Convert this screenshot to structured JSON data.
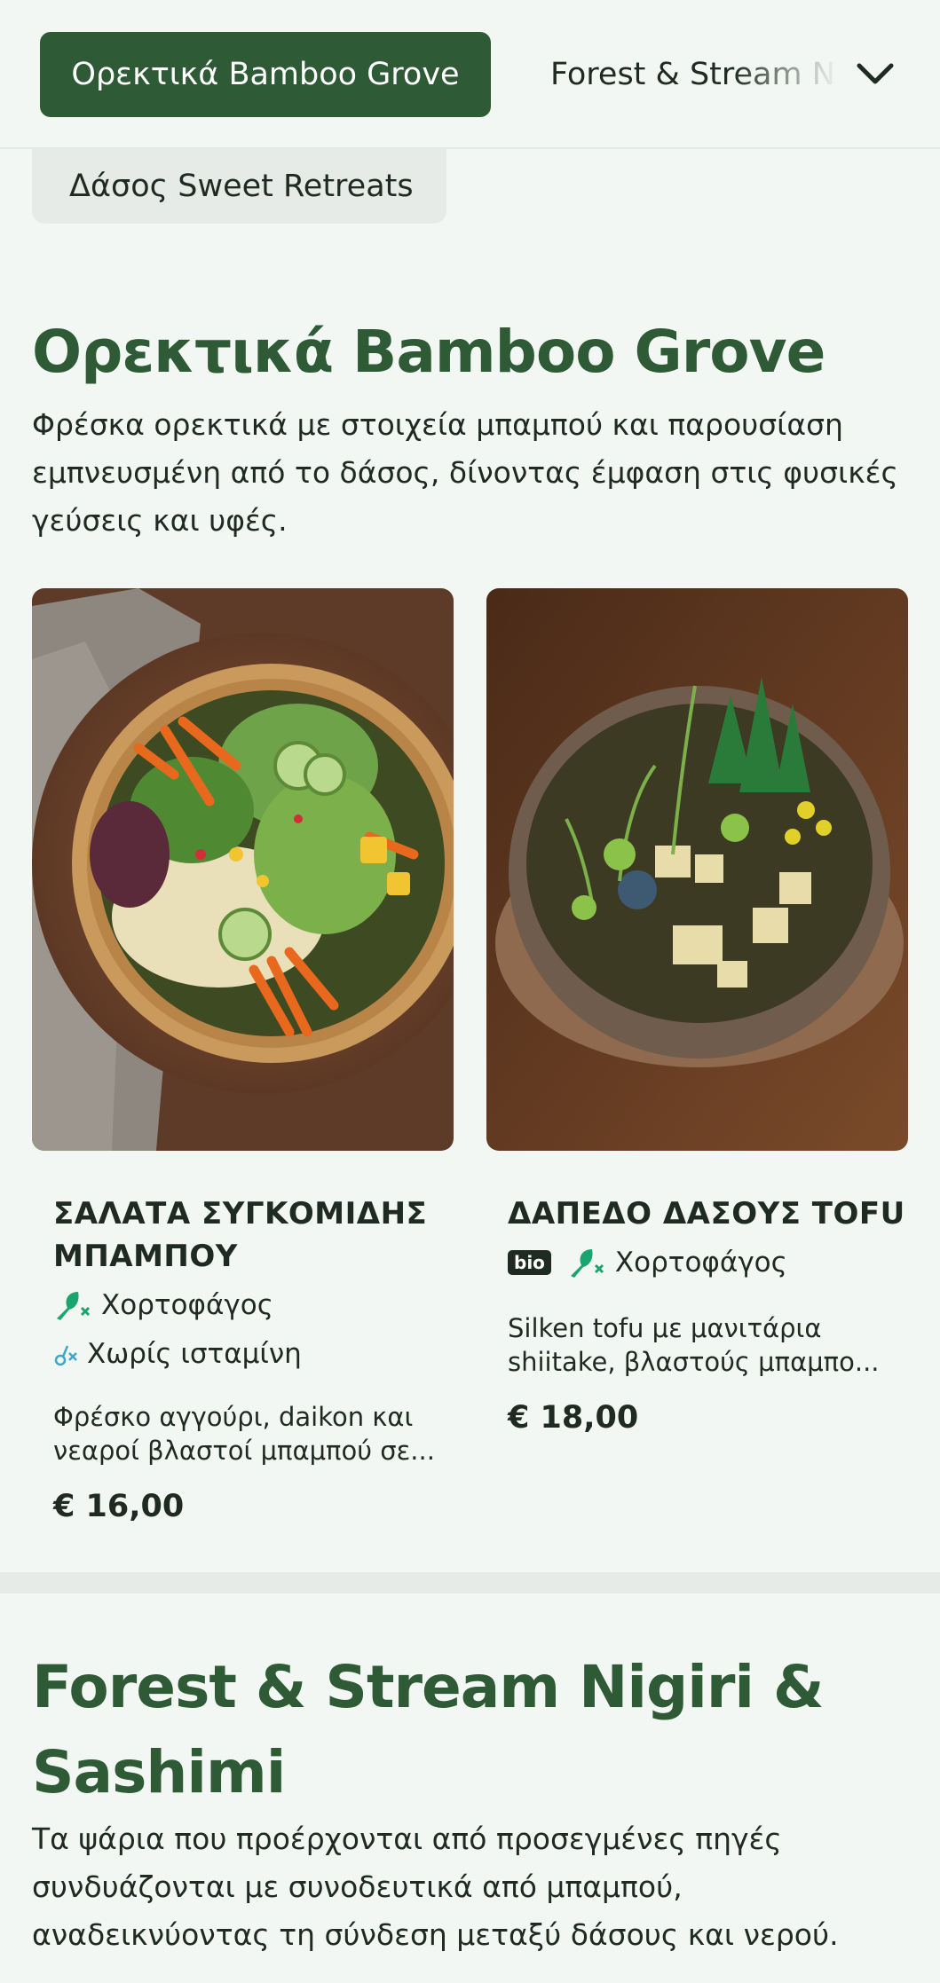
{
  "nav": {
    "active_tab": "Ορεκτικά Bamboo Grove",
    "next_tab": "Forest & Stream Nigiri & Sashimi",
    "below_tab": "Δάσος Sweet Retreats",
    "expand_icon": "chevron-down-icon"
  },
  "sections": [
    {
      "title": "Ορεκτικά Bamboo Grove",
      "description": "Φρέσκα ορεκτικά με στοιχεία μπαμπού και παρουσίαση εμπνευσμένη από το δάσος, δίνοντας έμφαση στις φυσικές γεύσεις και υφές.",
      "items": [
        {
          "title_line1": "ΣΑΛΑΤΑ ΣΥΓΚΟΜΙΔΗΣ",
          "title_line2": "ΜΠΑΜΠΟΥ",
          "tags": [
            "Χορτοφάγος",
            "Χωρίς ισταμίνη"
          ],
          "description_line1": "Φρέσκο αγγούρι, daikon και",
          "description_line2": "νεαροί βλαστοί μπαμπού σε...",
          "price": "€ 16,00"
        },
        {
          "title_line1": "ΔΑΠΕΔΟ ΔΑΣΟΥΣ TOFU",
          "badge": "bio",
          "tags": [
            "Χορτοφάγος"
          ],
          "description_line1": "Silken tofu με μανιτάρια",
          "description_line2": "shiitake, βλαστούς μπαμπο...",
          "price": "€ 18,00"
        }
      ]
    },
    {
      "title_line1": "Forest & Stream Nigiri &",
      "title_line2": "Sashimi",
      "description": "Τα ψάρια που προέρχονται από προσεγμένες πηγές συνδυάζονται με συνοδευτικά από μπαμπού, αναδεικνύοντας τη σύνδεση μεταξύ δάσους και νερού."
    }
  ],
  "colors": {
    "brand_green": "#2f5a36",
    "tag_green": "#1aa56e",
    "background": "#f3f7f3"
  }
}
